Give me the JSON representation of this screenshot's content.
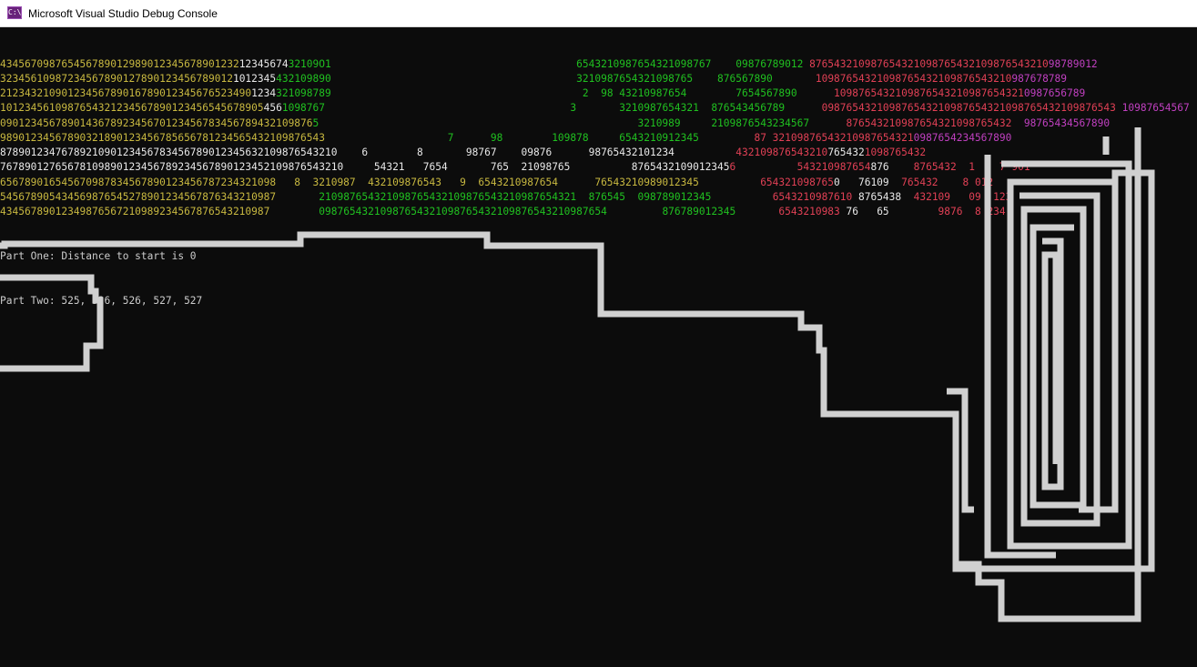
{
  "window": {
    "title": "Microsoft Visual Studio Debug Console",
    "icon": "visual-studio-console-icon",
    "icon_glyph": "C:\\"
  },
  "colors": {
    "background": "#0c0c0c",
    "yellow": "#c8b840",
    "green": "#20c020",
    "red": "#e04055",
    "magenta": "#c040c0",
    "path": "#d0d0d0",
    "status": "#cccccc"
  },
  "console": {
    "lines": [
      [
        [
          "y",
          "434567098765456789012989012345678901232"
        ],
        [
          "w",
          "12345674"
        ],
        [
          "g",
          "32109O1                                        6543210987654321098767    09876789012 "
        ],
        [
          "r",
          "876543210987654321098765432109876543210"
        ],
        [
          "m",
          "98789012"
        ]
      ],
      [
        [
          "y",
          "32345610987234567890127890123456789012"
        ],
        [
          "w",
          "1012345"
        ],
        [
          "g",
          "432109890                                        3210987654321098765    876567890       "
        ],
        [
          "r",
          "10987654321098765432109876543210"
        ],
        [
          "m",
          "987678789"
        ]
      ],
      [
        [
          "y",
          "21234321090123456789016789012345676523490"
        ],
        [
          "w",
          "1234"
        ],
        [
          "g",
          "321098789                                         2  98 43210987654        7654567890      "
        ],
        [
          "r",
          "1098765432109876543210987654321"
        ],
        [
          "m",
          "0987656789"
        ]
      ],
      [
        [
          "y",
          "1012345610987654321234567890123456545678905"
        ],
        [
          "w",
          "456"
        ],
        [
          "g",
          "1098767                                        3       3210987654321  876543456789      "
        ],
        [
          "r",
          "098765432109876543210987654321098765432109876543"
        ],
        [
          "m",
          " 10987654567"
        ]
      ],
      [
        [
          "y",
          "090123456789014367892345670123456783456789432109876"
        ],
        [
          "g",
          "5                                                    3210989     2109876543234567      "
        ],
        [
          "r",
          "876543210987654321098765432"
        ],
        [
          "m",
          "  98765434567890"
        ]
      ],
      [
        [
          "y",
          "98901234567890321890123456785656781234565432109876543"
        ],
        [
          "g",
          "                    7      98        109878     6543210912345         "
        ],
        [
          "r",
          "87 32109876543210987654321"
        ],
        [
          "m",
          "0987654234567890"
        ]
      ],
      [
        [
          "w",
          "8789012347678921090123456783456789012345632109876543210    6        8       98767    09876      98765432101234          "
        ],
        [
          "r",
          "432109876543210"
        ],
        [
          "c",
          "765432"
        ],
        [
          "r",
          "1098765432"
        ]
      ],
      [
        [
          "w",
          "76789012765678109890123456789234567890123452109876543210     54321   7654       765  21098765          8765432109012345"
        ],
        [
          "r",
          "6          543210987654"
        ],
        [
          "c",
          "876"
        ],
        [
          "r",
          "    8765432  1    7 901"
        ]
      ],
      [
        [
          "y",
          "656789016545670987834567890123456787234321098   8  3210987  432109876543   9  6543210987654      76543210989012345"
        ],
        [
          "r",
          "          654321098765"
        ],
        [
          "c",
          "0   76109"
        ],
        [
          "r",
          "  765432    8 012"
        ]
      ],
      [
        [
          "y",
          "545678905434569876545278901234567876343210987"
        ],
        [
          "g",
          "       210987654321098765432109876543210987654321  876545  098789012345          "
        ],
        [
          "r",
          "6543210987610"
        ],
        [
          "c",
          " 8765438"
        ],
        [
          "r",
          "  432109   09  123"
        ]
      ],
      [
        [
          "y",
          "43456789012349876567210989234567876543210987"
        ],
        [
          "g",
          "        09876543210987654321098765432109876543210987654         876789012345     "
        ],
        [
          "r",
          "  6543210983"
        ],
        [
          "c",
          " 76   65"
        ],
        [
          "r",
          "        9876  8 234"
        ]
      ]
    ],
    "status_lines": [
      "Part One: Distance to start is 0",
      "Part Two: 525, 526, 526, 527, 527"
    ]
  }
}
